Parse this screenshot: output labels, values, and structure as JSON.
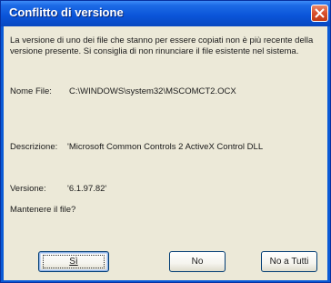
{
  "window": {
    "title": "Conflitto di versione"
  },
  "icons": {
    "close": "close-icon"
  },
  "message": "La versione di uno dei file che stanno per essere copiati non è più recente della versione presente. Si consiglia di non rinunciare il file esistente nel sistema.",
  "file": {
    "label": "Nome File:",
    "value": "C:\\WINDOWS\\system32\\MSCOMCT2.OCX"
  },
  "description": {
    "label": "Descrizione:",
    "value": "'Microsoft Common Controls 2 ActiveX Control DLL"
  },
  "version": {
    "label": "Versione:",
    "value": "'6.1.97.82'"
  },
  "question": "Mantenere il file?",
  "buttons": {
    "yes": "Sì",
    "no": "No",
    "no_to_all": "No a Tutti"
  }
}
